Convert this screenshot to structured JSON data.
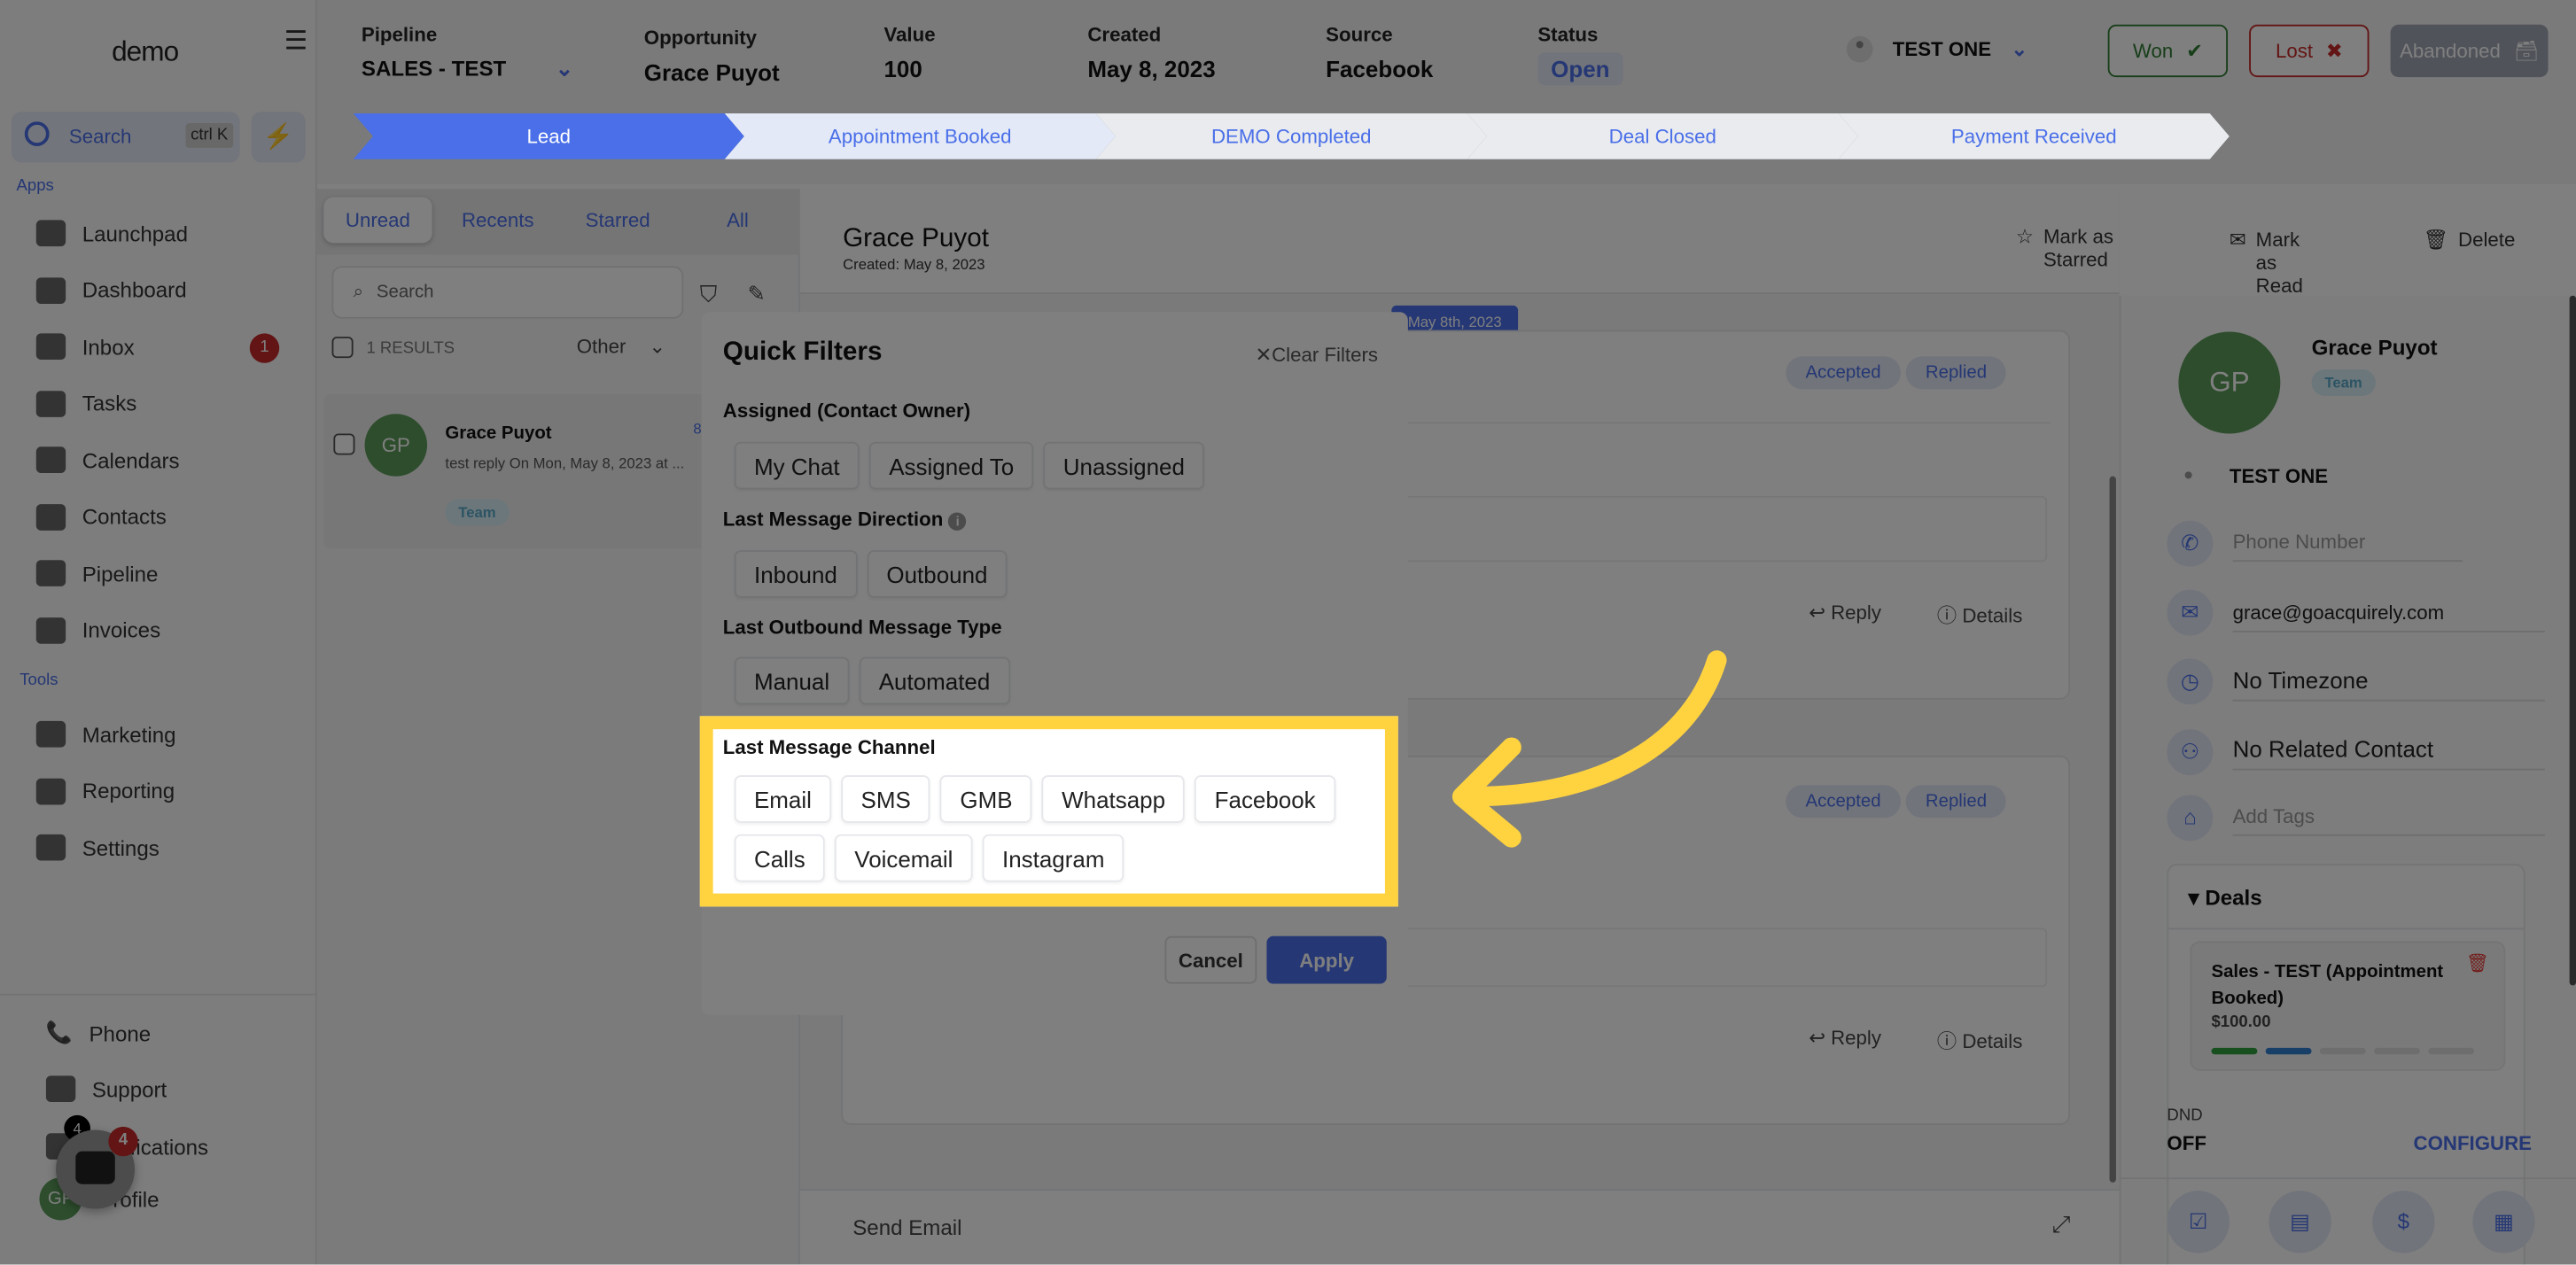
{
  "sidebar": {
    "logo": "demo",
    "search_label": "Search",
    "search_shortcut": "ctrl K",
    "apps_label": "Apps",
    "tools_label": "Tools",
    "apps": [
      {
        "label": "Launchpad"
      },
      {
        "label": "Dashboard"
      },
      {
        "label": "Inbox",
        "badge": "1"
      },
      {
        "label": "Tasks"
      },
      {
        "label": "Calendars"
      },
      {
        "label": "Contacts"
      },
      {
        "label": "Pipeline"
      },
      {
        "label": "Invoices"
      }
    ],
    "tools": [
      {
        "label": "Marketing"
      },
      {
        "label": "Reporting"
      },
      {
        "label": "Settings"
      }
    ],
    "bottom": [
      {
        "label": "Phone"
      },
      {
        "label": "Support"
      },
      {
        "label": "Notifications",
        "badge": "4"
      },
      {
        "label": "Profile",
        "avatar": "GP"
      }
    ],
    "chat_widget_badge": "4"
  },
  "header": {
    "pipeline_label": "Pipeline",
    "pipeline_value": "SALES - TEST",
    "opportunity_label": "Opportunity",
    "opportunity_value": "Grace Puyot",
    "value_label": "Value",
    "value_value": "100",
    "created_label": "Created",
    "created_value": "May 8, 2023",
    "source_label": "Source",
    "source_value": "Facebook",
    "status_label": "Status",
    "status_value": "Open",
    "owner": "TEST ONE",
    "won": "Won",
    "lost": "Lost",
    "abandoned": "Abandoned"
  },
  "stages": [
    {
      "label": "Lead",
      "active": true
    },
    {
      "label": "Appointment Booked"
    },
    {
      "label": "DEMO Completed"
    },
    {
      "label": "Deal Closed"
    },
    {
      "label": "Payment Received"
    }
  ],
  "conversations": {
    "tabs": [
      "Unread",
      "Recents",
      "Starred",
      "All"
    ],
    "active_tab": "Unread",
    "search_placeholder": "Search",
    "results": "1 RESULTS",
    "sort": "Other",
    "items": [
      {
        "avatar": "GP",
        "name": "Grace Puyot",
        "preview": "test reply On Mon, May 8, 2023 at ...",
        "time": "8",
        "tag": "Team"
      }
    ]
  },
  "thread": {
    "name": "Grace Puyot",
    "created": "Created: May 8, 2023",
    "mark_starred": "Mark as Starred",
    "mark_read": "Mark as Read",
    "delete": "Delete",
    "date_chip": "May 8th, 2023",
    "messages": [
      {
        "pills": [
          "Accepted",
          "Replied"
        ],
        "reply": "Reply",
        "details": "Details"
      },
      {
        "pills": [
          "Accepted",
          "Replied"
        ],
        "reply": "Reply",
        "details": "Details"
      }
    ],
    "composer": "Send Email"
  },
  "contact": {
    "avatar": "GP",
    "name": "Grace Puyot",
    "tag": "Team",
    "owner": "TEST ONE",
    "phone_placeholder": "Phone Number",
    "email": "grace@goacquirely.com",
    "timezone": "No Timezone",
    "related": "No Related Contact",
    "tags_placeholder": "Add Tags",
    "deals_title": "Deals",
    "deal": {
      "title": "Sales - TEST (Appointment Booked)",
      "amount": "$100.00",
      "progress_stages_complete": 2,
      "progress_stages_total": 5
    },
    "dnd_label": "DND",
    "dnd_value": "OFF",
    "configure": "CONFIGURE"
  },
  "quick_filters": {
    "title": "Quick Filters",
    "clear": "Clear Filters",
    "assigned_title": "Assigned (Contact Owner)",
    "assigned": [
      "My Chat",
      "Assigned To",
      "Unassigned"
    ],
    "direction_title": "Last Message Direction",
    "direction": [
      "Inbound",
      "Outbound"
    ],
    "type_title": "Last Outbound Message Type",
    "type": [
      "Manual",
      "Automated"
    ],
    "channel_title": "Last Message Channel",
    "channel": [
      "Email",
      "SMS",
      "GMB",
      "Whatsapp",
      "Facebook",
      "Calls",
      "Voicemail",
      "Instagram"
    ],
    "cancel": "Cancel",
    "apply": "Apply"
  },
  "colors": {
    "primary": "#4a6fe8",
    "highlight": "#ffd340",
    "won": "#2e7d32",
    "lost": "#c62828",
    "avatar": "#5a9a5a"
  }
}
